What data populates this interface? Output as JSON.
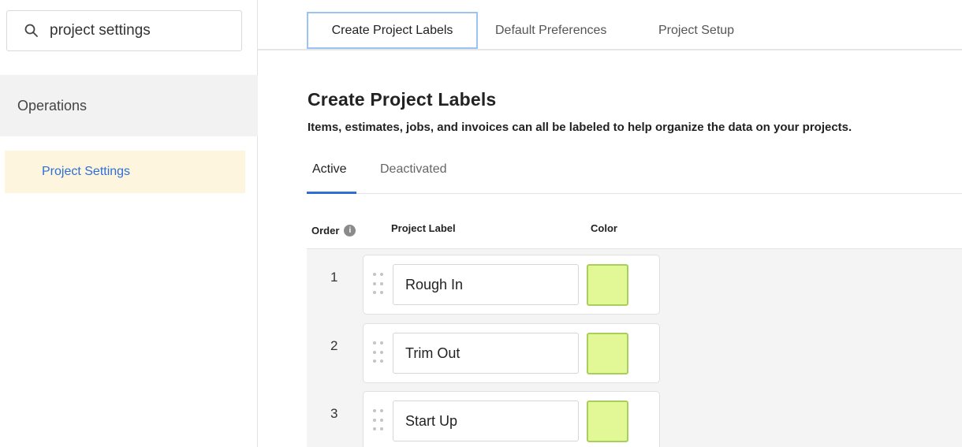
{
  "search": {
    "value": "project settings",
    "icon": "search-icon"
  },
  "sidebar": {
    "section": "Operations",
    "active_item": "Project Settings"
  },
  "top_tabs": [
    {
      "label": "Create Project Labels",
      "active": true
    },
    {
      "label": "Default Preferences",
      "active": false
    },
    {
      "label": "Project Setup",
      "active": false
    }
  ],
  "page": {
    "title": "Create Project Labels",
    "description": "Items, estimates, jobs, and invoices can all be labeled to help organize the data on your projects."
  },
  "sub_tabs": [
    {
      "label": "Active",
      "active": true
    },
    {
      "label": "Deactivated",
      "active": false
    }
  ],
  "table": {
    "headers": {
      "order": "Order",
      "label": "Project Label",
      "color": "Color",
      "info_icon": "info-icon"
    },
    "rows": [
      {
        "order": "1",
        "label": "Rough In",
        "color": "#e2f796"
      },
      {
        "order": "2",
        "label": "Trim Out",
        "color": "#e2f796"
      },
      {
        "order": "3",
        "label": "Start Up",
        "color": "#e2f796"
      }
    ]
  },
  "colors": {
    "accent": "#2e6fd6",
    "active_tab_border": "#9dc2f5",
    "highlight": "#fdf5dd"
  }
}
